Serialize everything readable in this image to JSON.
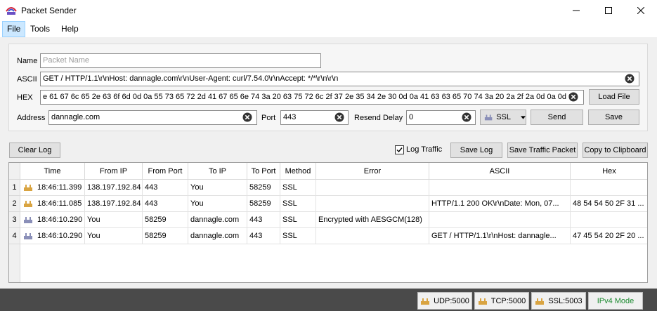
{
  "window": {
    "title": "Packet Sender"
  },
  "menu": {
    "file": "File",
    "tools": "Tools",
    "help": "Help"
  },
  "form": {
    "name_label": "Name",
    "name_placeholder": "Packet Name",
    "ascii_label": "ASCII",
    "ascii_value": "GET / HTTP/1.1\\r\\nHost: dannagle.com\\r\\nUser-Agent: curl/7.54.0\\r\\nAccept: */*\\r\\n\\r\\n",
    "hex_label": "HEX",
    "hex_value": "e 61 67 6c 65 2e 63 6f 6d 0d 0a 55 73 65 72 2d 41 67 65 6e 74 3a 20 63 75 72 6c 2f 37 2e 35 34 2e 30 0d 0a 41 63 63 65 70 74 3a 20 2a 2f 2a 0d 0a 0d 0a",
    "load_file": "Load File",
    "address_label": "Address",
    "address_value": "dannagle.com",
    "port_label": "Port",
    "port_value": "443",
    "resend_label": "Resend Delay",
    "resend_value": "0",
    "protocol": "SSL",
    "send": "Send",
    "save": "Save"
  },
  "toolbar": {
    "clear_log": "Clear Log",
    "log_traffic": "Log Traffic",
    "log_traffic_checked": true,
    "save_log": "Save Log",
    "save_traffic_packet": "Save Traffic Packet",
    "copy_clipboard": "Copy to Clipboard"
  },
  "table": {
    "headers": [
      "Time",
      "From IP",
      "From Port",
      "To IP",
      "To Port",
      "Method",
      "Error",
      "ASCII",
      "Hex"
    ],
    "rows": [
      {
        "num": "1",
        "direction": "incoming",
        "time": "18:46:11.399",
        "from_ip": "138.197.192.84",
        "from_port": "443",
        "to_ip": "You",
        "to_port": "58259",
        "method": "SSL",
        "error": "",
        "ascii": "",
        "hex": ""
      },
      {
        "num": "2",
        "direction": "incoming",
        "time": "18:46:11.085",
        "from_ip": "138.197.192.84",
        "from_port": "443",
        "to_ip": "You",
        "to_port": "58259",
        "method": "SSL",
        "error": "",
        "ascii": "HTTP/1.1 200 OK\\r\\nDate: Mon, 07...",
        "hex": "48 54 54 50 2F 31 ..."
      },
      {
        "num": "3",
        "direction": "outgoing",
        "time": "18:46:10.290",
        "from_ip": "You",
        "from_port": "58259",
        "to_ip": "dannagle.com",
        "to_port": "443",
        "method": "SSL",
        "error": "Encrypted with AESGCM(128)",
        "ascii": "",
        "hex": ""
      },
      {
        "num": "4",
        "direction": "outgoing",
        "time": "18:46:10.290",
        "from_ip": "You",
        "from_port": "58259",
        "to_ip": "dannagle.com",
        "to_port": "443",
        "method": "SSL",
        "error": "",
        "ascii": "GET / HTTP/1.1\\r\\nHost: dannagle...",
        "hex": "47 45 54 20 2F 20 ..."
      }
    ]
  },
  "status": {
    "udp": "UDP:5000",
    "tcp": "TCP:5000",
    "ssl": "SSL:5003",
    "ipv4": "IPv4 Mode"
  },
  "icons": {
    "app": "packet-sender-icon",
    "incoming": "incoming-packet-icon",
    "outgoing": "outgoing-packet-icon",
    "clear": "clear-icon"
  },
  "colors": {
    "ipv4_text": "#1b8a2f",
    "incoming_icon": "#d9a441",
    "outgoing_icon": "#8a8fb8",
    "statusbar": "#4a4a4a"
  }
}
